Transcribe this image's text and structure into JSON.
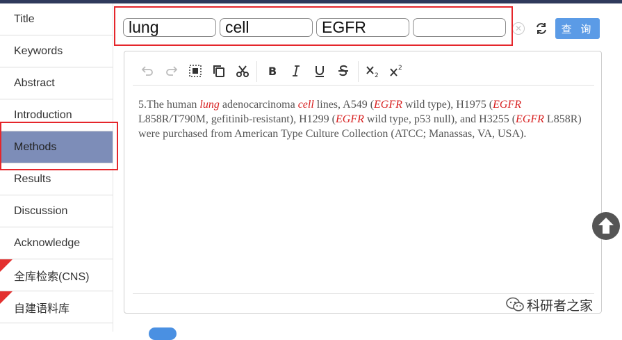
{
  "sidebar": {
    "items": [
      {
        "label": "Title",
        "active": false,
        "new": false
      },
      {
        "label": "Keywords",
        "active": false,
        "new": false
      },
      {
        "label": "Abstract",
        "active": false,
        "new": false
      },
      {
        "label": "Introduction",
        "active": false,
        "new": false
      },
      {
        "label": "Methods",
        "active": true,
        "new": false
      },
      {
        "label": "Results",
        "active": false,
        "new": false
      },
      {
        "label": "Discussion",
        "active": false,
        "new": false
      },
      {
        "label": "Acknowledge",
        "active": false,
        "new": false
      },
      {
        "label": "全库检索(CNS)",
        "active": false,
        "new": true
      },
      {
        "label": "自建语料库",
        "active": false,
        "new": true
      }
    ]
  },
  "search": {
    "keywords": [
      "lung",
      "cell",
      "EGFR",
      ""
    ],
    "query_label": "查 询"
  },
  "editor": {
    "content": {
      "index": "5.",
      "segments": [
        {
          "text": "The human ",
          "highlight": false
        },
        {
          "text": "lung",
          "highlight": true
        },
        {
          "text": " adenocarcinoma ",
          "highlight": false
        },
        {
          "text": "cell",
          "highlight": true
        },
        {
          "text": " lines, A549 (",
          "highlight": false
        },
        {
          "text": "EGFR",
          "highlight": true
        },
        {
          "text": " wild type), H1975 (",
          "highlight": false
        },
        {
          "text": "EGFR",
          "highlight": true
        },
        {
          "text": " L858R/T790M, gefitinib-resistant), H1299 (",
          "highlight": false
        },
        {
          "text": "EGFR",
          "highlight": true
        },
        {
          "text": " wild type, p53 null), and H3255 (",
          "highlight": false
        },
        {
          "text": "EGFR",
          "highlight": true
        },
        {
          "text": " L858R) were purchased from American Type Culture Collection (ATCC; Manassas, VA, USA).",
          "highlight": false
        }
      ]
    }
  },
  "watermark": {
    "text": "科研者之家",
    "icon": "wechat-icon"
  },
  "colors": {
    "highlight": "#d71f1f",
    "active_item": "#7d8db8",
    "button": "#5b9be6",
    "annotation": "#e5262b"
  }
}
